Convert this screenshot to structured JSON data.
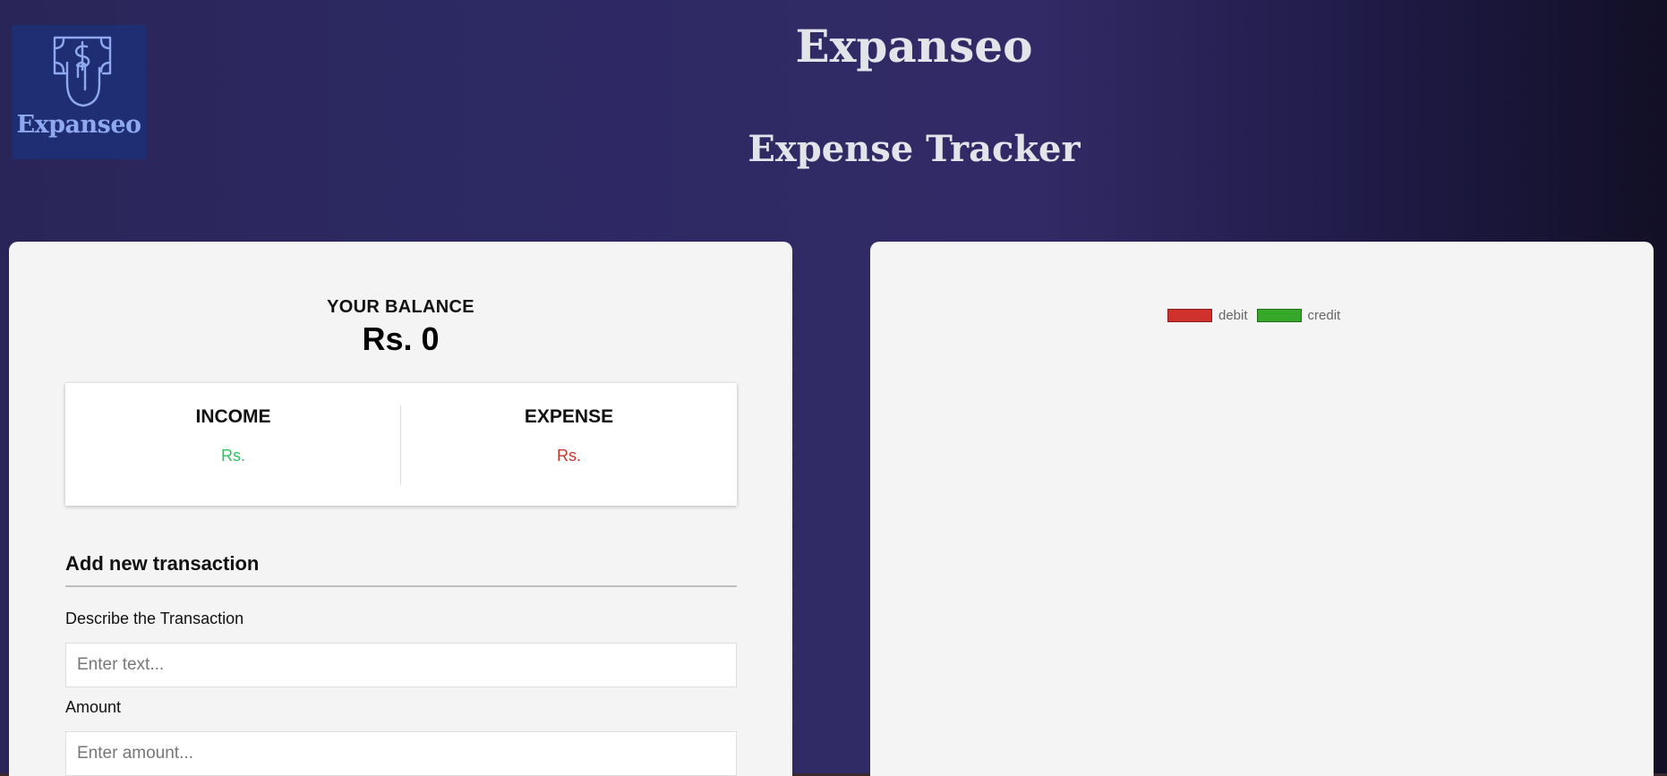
{
  "logo": {
    "text": "Expanseo",
    "icon": "money-hand-icon",
    "background": "#1f2e73",
    "accent": "#8ea9f0"
  },
  "header": {
    "title": "Expanseo",
    "subtitle": "Expense Tracker"
  },
  "balance": {
    "label": "YOUR BALANCE",
    "value": "Rs. 0"
  },
  "summary": {
    "income_label": "INCOME",
    "income_value": "Rs.",
    "expense_label": "EXPENSE",
    "expense_value": "Rs.",
    "income_color": "#2ec45c",
    "expense_color": "#c0392b"
  },
  "form": {
    "title": "Add new transaction",
    "description_label": "Describe the Transaction",
    "description_placeholder": "Enter text...",
    "description_value": "",
    "amount_label": "Amount",
    "amount_placeholder": "Enter amount...",
    "amount_value": ""
  },
  "chart_data": {
    "type": "bar",
    "series": [
      {
        "name": "debit",
        "color": "#d0312d",
        "values": []
      },
      {
        "name": "credit",
        "color": "#35a82a",
        "values": []
      }
    ],
    "legend_position": "top-center"
  }
}
